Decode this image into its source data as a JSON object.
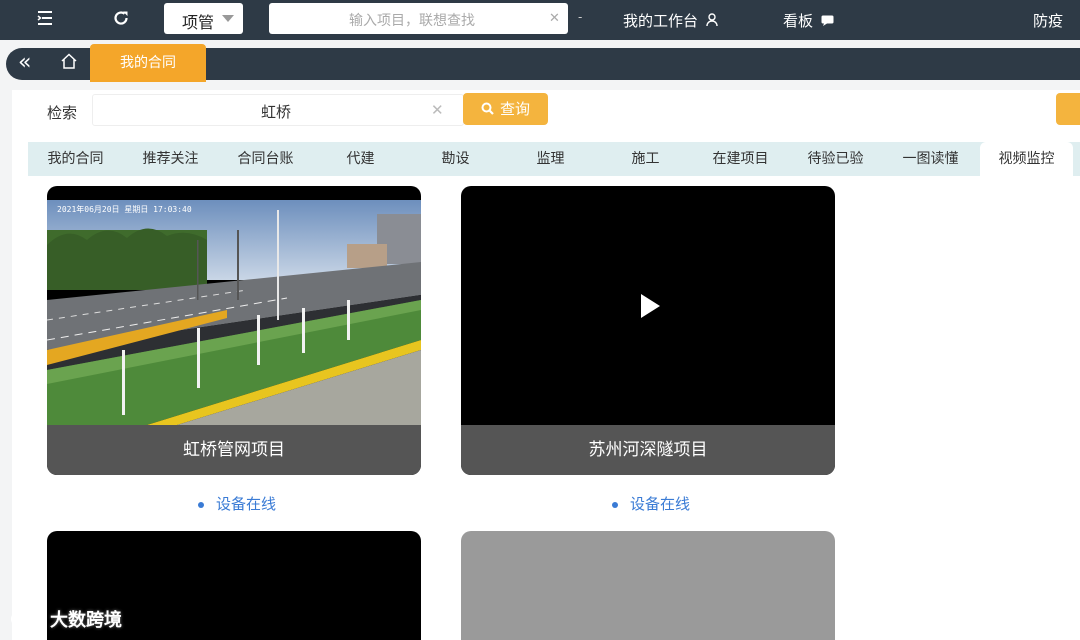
{
  "topbar": {
    "project_select": "项管",
    "search_placeholder": "输入项目，联想查找",
    "workbench": "我的工作台",
    "board": "看板",
    "epidemic": "防疫"
  },
  "tabstrip": {
    "active_tab": "我的合同"
  },
  "search": {
    "label": "检索",
    "value": "虹桥",
    "button": "查询"
  },
  "nav_tabs": [
    "我的合同",
    "推荐关注",
    "合同台账",
    "代建",
    "勘设",
    "监理",
    "施工",
    "在建项目",
    "待验已验",
    "一图读懂",
    "视频监控"
  ],
  "active_nav_tab": "视频监控",
  "cameras": [
    {
      "title": "虹桥管网项目",
      "status": "设备在线",
      "timestamp_overlay": "2021年06月20日 星期日 17:03:40"
    },
    {
      "title": "苏州河深隧项目",
      "status": "设备在线"
    }
  ],
  "watermark": "大数跨境",
  "colors": {
    "topbar": "#2e3a46",
    "accent": "#f4a62a",
    "status_blue": "#3a7bd5",
    "card_title_bg": "#555555"
  }
}
